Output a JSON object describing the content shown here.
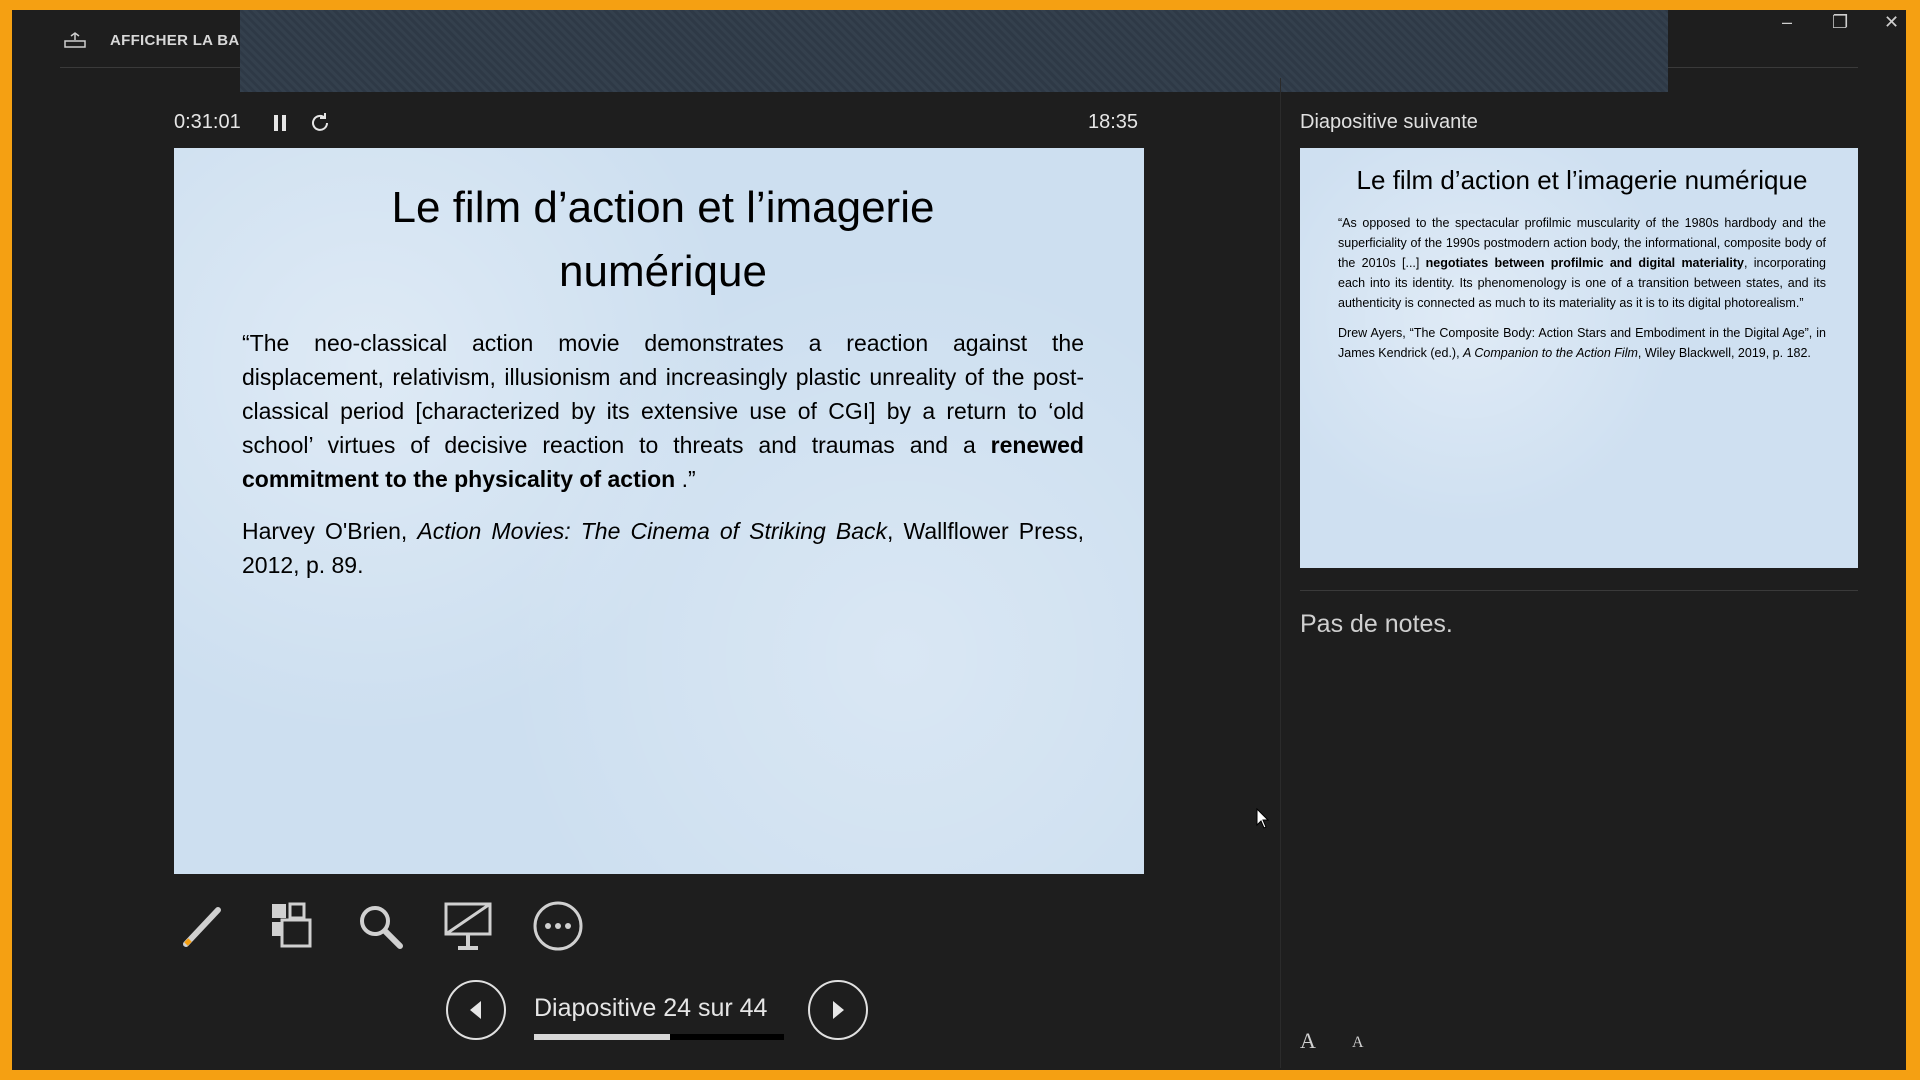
{
  "titlebar": {
    "label": "AFFICHER LA BARR",
    "minimize": "–",
    "maximize": "❐",
    "close": "✕"
  },
  "presenter": {
    "timer": "0:31:01",
    "clock": "18:35"
  },
  "current_slide": {
    "title": "Le film d’action et l’imagerie numérique",
    "quote_part1": "“The neo-classical action movie demonstrates a reaction against the displacement, relativism, illusionism and increasingly plastic unreality of the post-classical period [characterized by its extensive use of CGI] by a return to ‘old school’ virtues of decisive reaction to threats and traumas and a ",
    "quote_bold": "renewed commitment to the physicality of action",
    "quote_end": " .”",
    "cite_author": " Harvey O'Brien, ",
    "cite_title": "Action Movies: The Cinema of Striking Back",
    "cite_rest": ", Wallflower Press, 2012, p. 89."
  },
  "toolbar": {
    "pen": "pen-icon",
    "see_all": "see-all-slides-icon",
    "zoom": "zoom-icon",
    "black_screen": "black-screen-icon",
    "more": "more-options-icon"
  },
  "navigation": {
    "counter": "Diapositive 24 sur 44",
    "progress": 0.545
  },
  "next_slide": {
    "label": "Diapositive suivante",
    "title": "Le film d’action et l’imagerie numérique",
    "quote_part1": "“As opposed to the spectacular profilmic muscularity of the 1980s hardbody and the superficiality of the 1990s postmodern action body, the informational, composite body of the 2010s [...] ",
    "quote_bold": "negotiates between profilmic and digital materiality",
    "quote_rest": ", incorporating each into its identity. Its phenomenology is one of a transition between states, and its authenticity is connected as much to its materiality as it is to its digital photorealism.”",
    "cite_part1": "Drew Ayers, “The Composite Body: Action Stars and Embodiment in the Digital Age”, in James Kendrick (ed.), ",
    "cite_title": "A Companion to the Action Film",
    "cite_rest": ", Wiley Blackwell, 2019, p. 182."
  },
  "notes": {
    "text": "Pas de notes."
  },
  "font_controls": {
    "increase": "A",
    "decrease": "A"
  },
  "colors": {
    "frame": "#f5a012",
    "background": "#1e1e1e",
    "slide_bg": "#cddff0"
  }
}
